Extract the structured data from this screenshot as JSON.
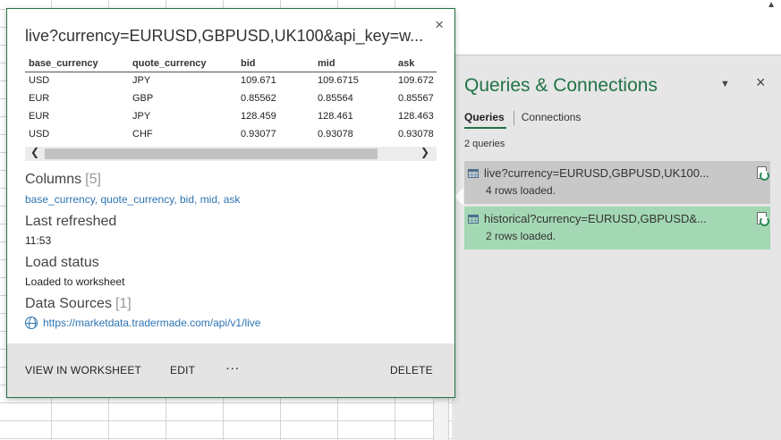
{
  "peek": {
    "title": "live?currency=EURUSD,GBPUSD,UK100&api_key=w...",
    "close_icon": "×",
    "preview": {
      "headers": [
        "base_currency",
        "quote_currency",
        "bid",
        "mid",
        "ask"
      ],
      "rows": [
        [
          "USD",
          "JPY",
          "109.671",
          "109.6715",
          "109.672"
        ],
        [
          "EUR",
          "GBP",
          "0.85562",
          "0.85564",
          "0.85567"
        ],
        [
          "EUR",
          "JPY",
          "128.459",
          "128.461",
          "128.463"
        ],
        [
          "USD",
          "CHF",
          "0.93077",
          "0.93078",
          "0.93078"
        ]
      ]
    },
    "columns": {
      "heading": "Columns",
      "count": "[5]",
      "items": [
        "base_currency",
        "quote_currency",
        "bid",
        "mid",
        "ask"
      ]
    },
    "last_refreshed": {
      "heading": "Last refreshed",
      "value": "11:53"
    },
    "load_status": {
      "heading": "Load status",
      "value": "Loaded to worksheet"
    },
    "data_sources": {
      "heading": "Data Sources",
      "count": "[1]",
      "url": "https://marketdata.tradermade.com/api/v1/live"
    },
    "footer": {
      "view": "VIEW IN WORKSHEET",
      "edit": "EDIT",
      "more": "···",
      "delete": "DELETE"
    }
  },
  "pane": {
    "title": "Queries & Connections",
    "dropdown_icon": "▼",
    "close_icon": "×",
    "tabs": [
      {
        "label": "Queries"
      },
      {
        "label": "Connections"
      }
    ],
    "count": "2 queries",
    "queries": [
      {
        "name": "live?currency=EURUSD,GBPUSD,UK100...",
        "status": "4 rows loaded."
      },
      {
        "name": "historical?currency=EURUSD,GBPUSD&...",
        "status": "2 rows loaded."
      }
    ]
  },
  "sheet": {
    "scroll_up_icon": "▲"
  },
  "colors": {
    "accent": "#217346",
    "link": "#2c74b3",
    "selected_query": "#a4d8b4"
  }
}
